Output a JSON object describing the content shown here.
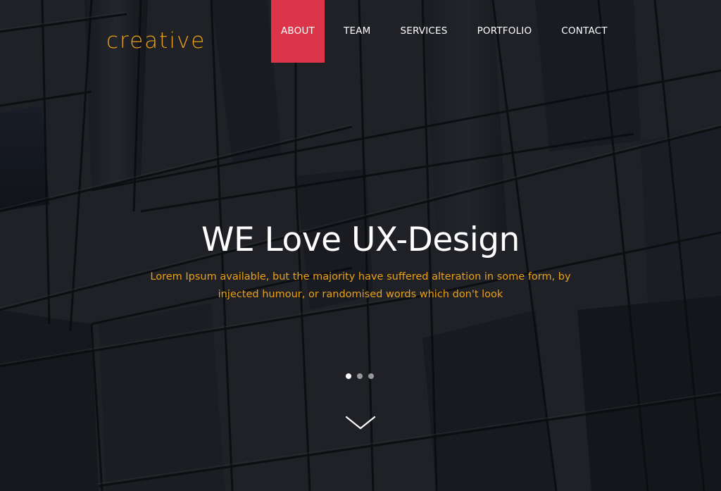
{
  "brand": {
    "logo_text": "creative",
    "accent_color": "#e9a117",
    "highlight_color": "#dc3448"
  },
  "nav": {
    "items": [
      {
        "label": "ABOUT",
        "active": true
      },
      {
        "label": "TEAM",
        "active": false
      },
      {
        "label": "SERVICES",
        "active": false
      },
      {
        "label": "PORTFOLIO",
        "active": false
      },
      {
        "label": "CONTACT",
        "active": false
      }
    ]
  },
  "hero": {
    "headline": "WE Love UX-Design",
    "subtext": "Lorem Ipsum available, but the majority have suffered alteration in some form, by injected humour, or randomised words which don't look",
    "slider": {
      "total": 3,
      "active_index": 0
    },
    "scroll_icon": "chevron-down-icon"
  }
}
